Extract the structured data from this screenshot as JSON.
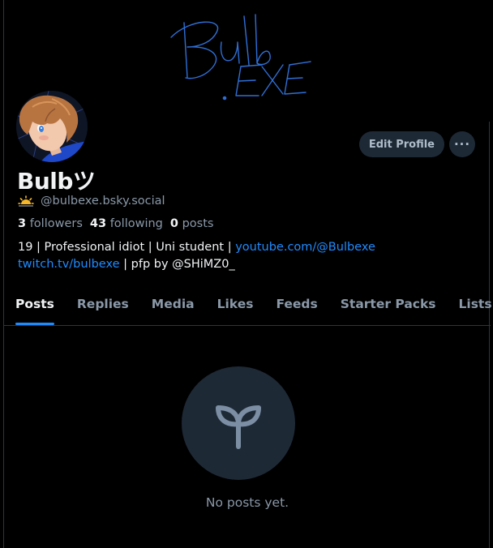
{
  "banner": {
    "line1": "Bulb",
    "line2": ".EXE",
    "ink_color": "#2f6fd6"
  },
  "profile": {
    "display_name": "Bulbツ",
    "handle": "@bulbexe.bsky.social",
    "handle_badge_icon": "sun-icon",
    "avatar_icon": "anime-boy-avatar",
    "stats": {
      "followers_count": "3",
      "followers_label": "followers",
      "following_count": "43",
      "following_label": "following",
      "posts_count": "0",
      "posts_label": "posts"
    },
    "bio": {
      "prefix": "19 | Professional idiot | Uni student | ",
      "link1": "youtube.com/@Bulbexe",
      "link2": "twitch.tv/bulbexe",
      "suffix": " | pfp by @SHiMZ0_"
    }
  },
  "actions": {
    "edit_label": "Edit Profile",
    "more_icon": "ellipsis-icon",
    "more_label": "···"
  },
  "tabs": [
    {
      "label": "Posts",
      "active": true
    },
    {
      "label": "Replies"
    },
    {
      "label": "Media"
    },
    {
      "label": "Likes"
    },
    {
      "label": "Feeds"
    },
    {
      "label": "Starter Packs"
    },
    {
      "label": "Lists"
    }
  ],
  "empty_state": {
    "icon": "sprout-icon",
    "message": "No posts yet."
  },
  "colors": {
    "accent": "#208bfe",
    "background": "#000000",
    "muted": "#8a98a8",
    "button_bg": "#1e2936"
  }
}
